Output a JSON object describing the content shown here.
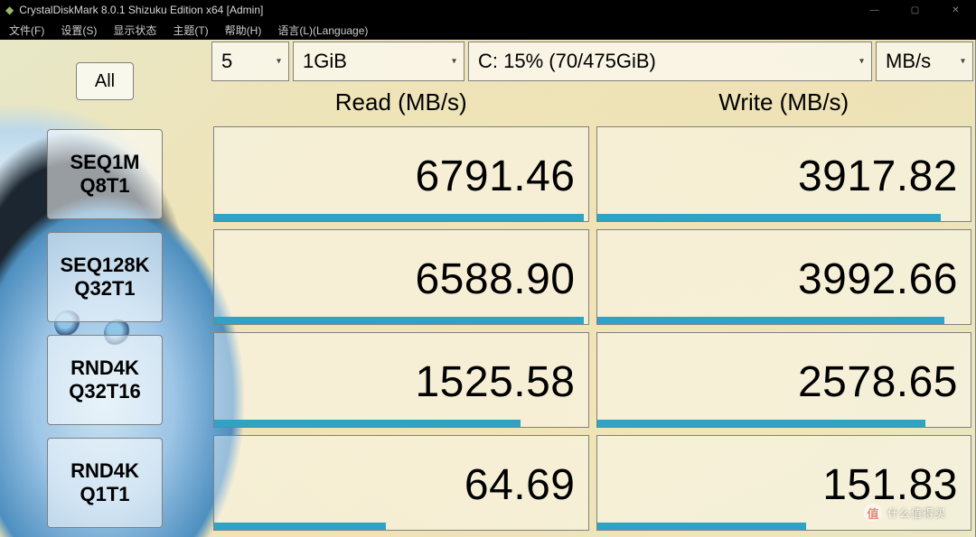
{
  "window": {
    "title": "CrystalDiskMark 8.0.1 Shizuku Edition x64 [Admin]",
    "icon_glyph": "◆",
    "controls": {
      "min": "—",
      "max": "▢",
      "close": "✕"
    }
  },
  "menubar": {
    "file": "文件(F)",
    "settings": "设置(S)",
    "view": "显示状态",
    "theme": "主题(T)",
    "help": "帮助(H)",
    "language": "语言(L)(Language)"
  },
  "toolbar": {
    "all_label": "All",
    "count_value": "5",
    "size_value": "1GiB",
    "drive_value": "C: 15% (70/475GiB)",
    "unit_value": "MB/s"
  },
  "headers": {
    "read": "Read (MB/s)",
    "write": "Write (MB/s)"
  },
  "rows": [
    {
      "line1": "SEQ1M",
      "line2": "Q8T1"
    },
    {
      "line1": "SEQ128K",
      "line2": "Q32T1"
    },
    {
      "line1": "RND4K",
      "line2": "Q32T16"
    },
    {
      "line1": "RND4K",
      "line2": "Q1T1"
    }
  ],
  "results": {
    "read": [
      "6791.46",
      "6588.90",
      "1525.58",
      "64.69"
    ],
    "write": [
      "3917.82",
      "3992.66",
      "2578.65",
      "151.83"
    ]
  },
  "bars_pct": {
    "read": [
      99,
      99,
      82,
      46
    ],
    "write": [
      92,
      93,
      88,
      56
    ]
  },
  "chart_data": {
    "type": "table",
    "title": "CrystalDiskMark 8.0.1 benchmark — C: drive, 5 passes, 1GiB, results in MB/s",
    "columns": [
      "Test",
      "Read (MB/s)",
      "Write (MB/s)"
    ],
    "rows": [
      [
        "SEQ1M Q8T1",
        6791.46,
        3917.82
      ],
      [
        "SEQ128K Q32T1",
        6588.9,
        3992.66
      ],
      [
        "RND4K Q32T16",
        1525.58,
        2578.65
      ],
      [
        "RND4K Q1T1",
        64.69,
        151.83
      ]
    ]
  },
  "watermark": "什么值得买"
}
